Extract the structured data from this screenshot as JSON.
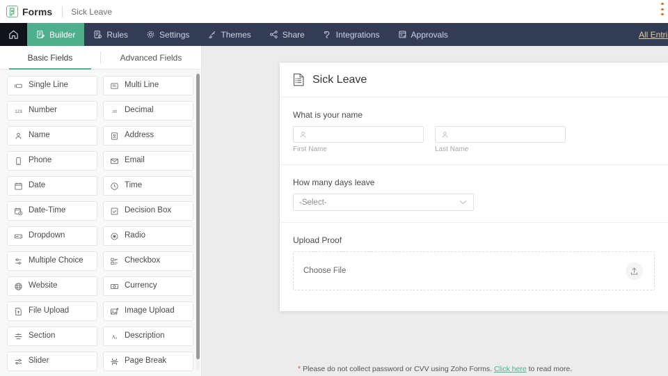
{
  "topbar": {
    "logo_icon": "zoho-forms-logo-icon",
    "brand": "Forms",
    "form_name": "Sick Leave",
    "menu_icon": "more-options-icon"
  },
  "nav": {
    "home_icon": "home-icon",
    "all_entries_label": "All Entries",
    "items": [
      {
        "label": "Builder",
        "icon": "builder-icon",
        "active": true
      },
      {
        "label": "Rules",
        "icon": "rules-icon",
        "active": false
      },
      {
        "label": "Settings",
        "icon": "gear-icon",
        "active": false
      },
      {
        "label": "Themes",
        "icon": "brush-icon",
        "active": false
      },
      {
        "label": "Share",
        "icon": "share-icon",
        "active": false
      },
      {
        "label": "Integrations",
        "icon": "integrations-icon",
        "active": false
      },
      {
        "label": "Approvals",
        "icon": "approvals-icon",
        "active": false
      }
    ]
  },
  "sidebar": {
    "tabs": [
      {
        "label": "Basic Fields",
        "active": true
      },
      {
        "label": "Advanced Fields",
        "active": false
      }
    ],
    "fields": [
      {
        "label": "Single Line",
        "icon": "single-line-icon"
      },
      {
        "label": "Multi Line",
        "icon": "multi-line-icon"
      },
      {
        "label": "Number",
        "icon": "number-icon"
      },
      {
        "label": "Decimal",
        "icon": "decimal-icon"
      },
      {
        "label": "Name",
        "icon": "person-icon"
      },
      {
        "label": "Address",
        "icon": "address-icon"
      },
      {
        "label": "Phone",
        "icon": "phone-icon"
      },
      {
        "label": "Email",
        "icon": "envelope-icon"
      },
      {
        "label": "Date",
        "icon": "calendar-icon"
      },
      {
        "label": "Time",
        "icon": "clock-icon"
      },
      {
        "label": "Date-Time",
        "icon": "calendar-clock-icon"
      },
      {
        "label": "Decision Box",
        "icon": "checkbox-icon"
      },
      {
        "label": "Dropdown",
        "icon": "dropdown-icon"
      },
      {
        "label": "Radio",
        "icon": "radio-icon"
      },
      {
        "label": "Multiple Choice",
        "icon": "multiple-choice-icon"
      },
      {
        "label": "Checkbox",
        "icon": "checkbox-list-icon"
      },
      {
        "label": "Website",
        "icon": "globe-icon"
      },
      {
        "label": "Currency",
        "icon": "currency-icon"
      },
      {
        "label": "File Upload",
        "icon": "file-upload-icon"
      },
      {
        "label": "Image Upload",
        "icon": "image-upload-icon"
      },
      {
        "label": "Section",
        "icon": "section-icon"
      },
      {
        "label": "Description",
        "icon": "description-icon"
      },
      {
        "label": "Slider",
        "icon": "slider-icon"
      },
      {
        "label": "Page Break",
        "icon": "page-break-icon"
      }
    ]
  },
  "form": {
    "icon": "form-document-icon",
    "title": "Sick Leave",
    "name_field": {
      "label": "What is your name",
      "first": {
        "sub_label": "First Name",
        "value": "",
        "icon": "person-icon"
      },
      "last": {
        "sub_label": "Last Name",
        "value": "",
        "icon": "person-icon"
      }
    },
    "days_field": {
      "label": "How many days leave",
      "value": "-Select-",
      "chevron_icon": "chevron-down-icon"
    },
    "upload_field": {
      "label": "Upload Proof",
      "choose_label": "Choose File",
      "icon": "upload-icon"
    }
  },
  "footer": {
    "star": "*",
    "text_before": "Please do not collect password or CVV using Zoho Forms.",
    "link": "Click here",
    "text_after": "to read more."
  }
}
